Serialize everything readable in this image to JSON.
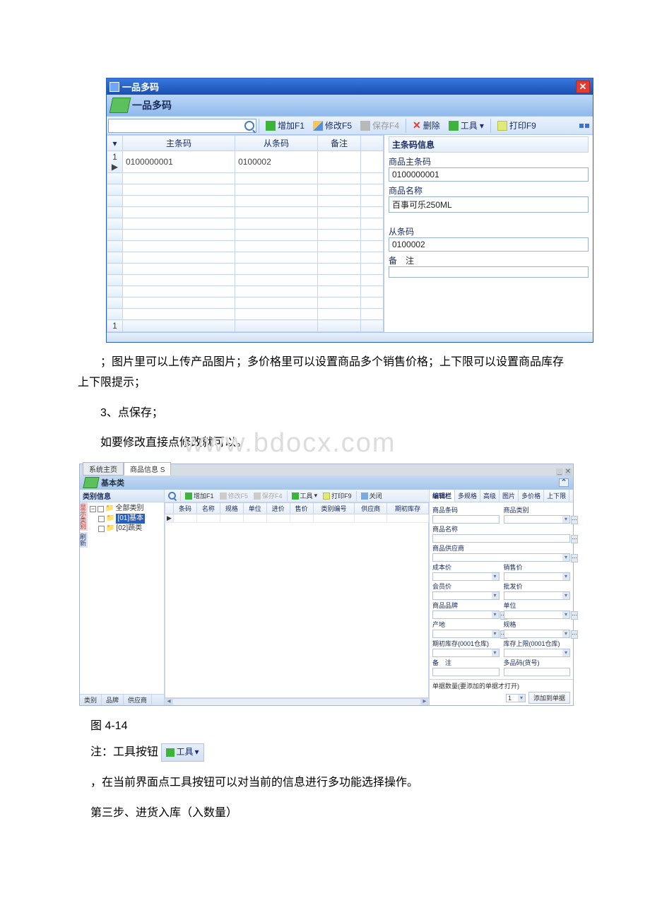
{
  "watermark": "www.bdocx.com",
  "win1": {
    "title": "一品多码",
    "ribbon_title": "一品多码",
    "toolbar": {
      "add": "增加F1",
      "edit": "修改F5",
      "save": "保存F4",
      "delete": "删除",
      "tools": "工具",
      "print": "打印F9"
    },
    "grid": {
      "col_main": "主条码",
      "col_sub": "从条码",
      "col_note": "备注",
      "row1_num": "1",
      "row1_marker": "▶",
      "row1_main": "0100000001",
      "row1_sub": "0100002",
      "footer_num": "1"
    },
    "info": {
      "head": "主条码信息",
      "l_main": "商品主条码",
      "v_main": "0100000001",
      "l_name": "商品名称",
      "v_name": "百事可乐250ML",
      "l_sub": "从条码",
      "v_sub": "0100002",
      "l_note": "备　注"
    }
  },
  "doc": {
    "p1": "；图片里可以上传产品图片；多价格里可以设置商品多个销售价格；上下限可以设置商品库存上下限提示；",
    "p2": "3、点保存；",
    "p3": "如要修改直接点修改就可以。",
    "fig": "图 4-14",
    "note_pre": "注：工具按钮 ",
    "tool_btn": "工具",
    "p4": "，在当前界面点工具按钮可以对当前的信息进行多功能选择操作。",
    "p5": "第三步、进货入库（入数量）"
  },
  "win2": {
    "tab1": "系统主页",
    "tab2": "商品信息 S",
    "ribbon": "基本类",
    "toolbar": {
      "add": "增加F1",
      "edit": "修改F5",
      "save": "保存F4",
      "tools": "工具",
      "print": "打印F9",
      "close": "关闭"
    },
    "sidebar": {
      "head": "类别信息",
      "vtab1": "显示类别",
      "vtab2": "刷新",
      "node_all": "全部类别",
      "node_jb": "[01]基本",
      "node_sc": "[02]蔬类",
      "btab1": "类别",
      "btab2": "品牌",
      "btab3": "供应商"
    },
    "grid_cols": {
      "c1": "条码",
      "c2": "名称",
      "c3": "规格",
      "c4": "单位",
      "c5": "进价",
      "c6": "售价",
      "c7": "类别编号",
      "c8": "供应商",
      "c9": "期初库存"
    },
    "rtabs": {
      "t1": "编辑栏",
      "t2": "多规格",
      "t3": "高级",
      "t4": "图片",
      "t5": "多价格",
      "t6": "上下限"
    },
    "form": {
      "f_barcode": "商品条码",
      "f_cat": "商品类别",
      "f_name": "商品名称",
      "f_sup": "商品供应商",
      "f_cost": "成本价",
      "f_sale": "销售价",
      "f_member": "会员价",
      "f_whole": "批发价",
      "f_brand": "商品品牌",
      "f_unit": "单位",
      "f_origin": "产地",
      "f_spec": "规格",
      "f_stock": "期初库存(0001仓库)",
      "f_limit": "库存上限(0001仓库)",
      "f_note": "备　注",
      "f_multi": "多品码(货号)"
    },
    "bottom": {
      "label": "单据数量(要添加的单据才打开)",
      "sel": "1",
      "btn": "添加到单据"
    }
  }
}
